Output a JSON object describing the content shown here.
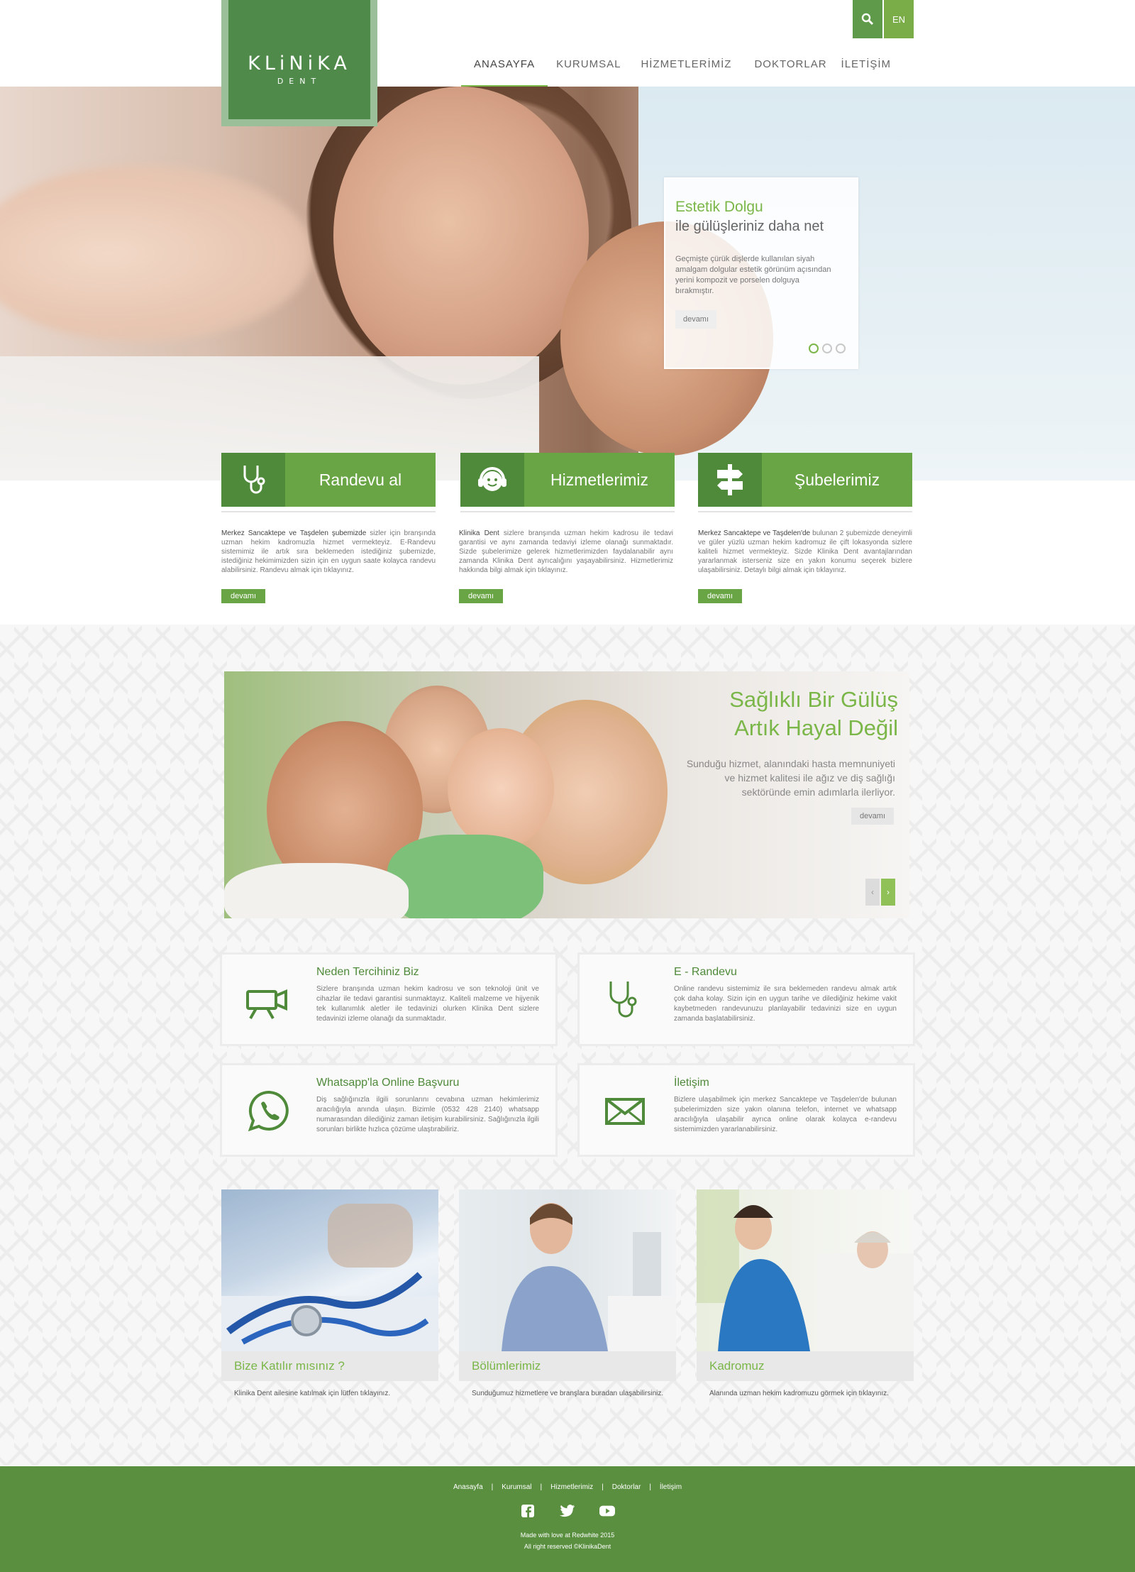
{
  "header": {
    "logo_main": "KLiNiKA",
    "logo_sub": "DENT",
    "lang": "EN",
    "nav": [
      {
        "label": "ANASAYFA",
        "active": true
      },
      {
        "label": "KURUMSAL",
        "active": false
      },
      {
        "label": "HİZMETLERİMİZ",
        "active": false
      },
      {
        "label": "DOKTORLAR",
        "active": false
      },
      {
        "label": "İLETİŞİM",
        "active": false
      }
    ],
    "icons": {
      "search": "search-icon"
    }
  },
  "hero": {
    "title": "Estetik Dolgu",
    "subtitle": "ile gülüşleriniz daha net",
    "text": "Geçmişte çürük dişlerde kullanılan siyah amalgam dolgular estetik görünüm açısından yerini kompozit ve porselen dolguya bırakmıştır.",
    "more": "devamı",
    "dots": 3,
    "active_dot": 0
  },
  "boxes": [
    {
      "label": "Randevu al",
      "icon": "stethoscope-icon",
      "lead": "Merkez Sancaktepe ve Taşdelen şubemizde",
      "text": " sizler için branşında uzman hekim kadromuzla hizmet vermekteyiz. E-Randevu sistemimiz ile artık sıra beklemeden istediğiniz şubemizde, istediğiniz hekimimizden sizin için en uygun saate kolayca randevu alabilirsiniz. Randevu almak için tıklayınız.",
      "more": "devamı"
    },
    {
      "label": "Hizmetlerimiz",
      "icon": "headset-icon",
      "lead": "Klinika Dent",
      "text": " sizlere branşında uzman hekim kadrosu ile tedavi garantisi ve aynı zamanda tedaviyi izleme olanağı sunmaktadır. Sizde şubelerimize gelerek hizmetlerimizden faydalanabilir aynı zamanda Klinika Dent ayrıcalığını yaşayabilirsiniz. Hizmetlerimiz hakkında bilgi almak için tıklayınız.",
      "more": "devamı"
    },
    {
      "label": "Şubelerimiz",
      "icon": "signpost-icon",
      "lead": "Merkez Sancaktepe ve Taşdelen'de",
      "text": " bulunan 2 şubemizde deneyimli ve güler yüzlü uzman hekim kadromuz ile çift lokasyonda sizlere kaliteli hizmet vermekteyiz. Sizde Klinika Dent avantajlarından yararlanmak isterseniz size en yakın konumu seçerek bizlere ulaşabilirsiniz. Detaylı bilgi almak için tıklayınız.",
      "more": "devamı"
    }
  ],
  "banner": {
    "title1": "Sağlıklı Bir Gülüş",
    "title2": "Artık Hayal Değil",
    "text": "Sunduğu hizmet, alanındaki hasta memnuniyeti ve hizmet kalitesi ile ağız ve diş sağlığı sektöründe emin adımlarla ilerliyor.",
    "more": "devamı",
    "prev": "‹",
    "next": "›"
  },
  "features": [
    {
      "title": "Neden Tercihiniz Biz",
      "icon": "video-camera-icon",
      "text": "Sizlere branşında uzman hekim kadrosu ve son teknoloji ünit ve cihazlar ile tedavi garantisi sunmaktayız. Kaliteli malzeme ve hijyenik tek kullanımlık aletler ile tedavinizi olurken Klinika Dent sizlere tedavinizi izleme olanağı da sunmaktadır."
    },
    {
      "title": "E - Randevu",
      "icon": "stethoscope-icon",
      "text": "Online randevu sistemimiz ile sıra beklemeden randevu almak artık çok daha kolay. Sizin için en uygun tarihe ve dilediğiniz hekime vakit kaybetmeden randevunuzu planlayabilir tedavinizi size en uygun zamanda başlatabilirsiniz."
    },
    {
      "title": "Whatsapp'la Online Başvuru",
      "icon": "whatsapp-icon",
      "text": "Diş sağlığınızla ilgili sorunlarını cevabına uzman hekimlerimiz aracılığıyla anında ulaşın. Bizimle (0532 428 2140) whatsapp numarasından dilediğiniz zaman iletişim kurabilirsiniz. Sağlığınızla ilgili sorunları birlikte hızlıca çözüme ulaştırabiliriz."
    },
    {
      "title": "İletişim",
      "icon": "envelope-icon",
      "text": "Bizlere ulaşabilmek için merkez Sancaktepe ve Taşdelen'de bulunan şubelerimizden size yakın olanına telefon, internet ve whatsapp aracılığıyla ulaşabilir ayrıca online olarak kolayca e-randevu sistemimizden yararlanabilirsiniz."
    }
  ],
  "cards": [
    {
      "caption": "Bize Katılır mısınız ?",
      "desc": "Klinika Dent ailesine katılmak için lütfen tıklayınız."
    },
    {
      "caption": "Bölümlerimiz",
      "desc": "Sunduğumuz hizmetlere ve branşlara buradan ulaşabilirsiniz."
    },
    {
      "caption": "Kadromuz",
      "desc": "Alanında uzman hekim kadromuzu görmek için tıklayınız."
    }
  ],
  "footer": {
    "links": [
      "Anasayfa",
      "Kurumsal",
      "Hizmetlerimiz",
      "Doktorlar",
      "İletişim"
    ],
    "separator": "|",
    "social": [
      "facebook-icon",
      "twitter-icon",
      "youtube-icon"
    ],
    "made": "Made with love at Redwhite 2015",
    "rights": "All right reserved ©KlinikaDent"
  },
  "colors": {
    "accent": "#6aa545",
    "dark_green": "#4f8a3a",
    "footer": "#5a8f3f"
  }
}
